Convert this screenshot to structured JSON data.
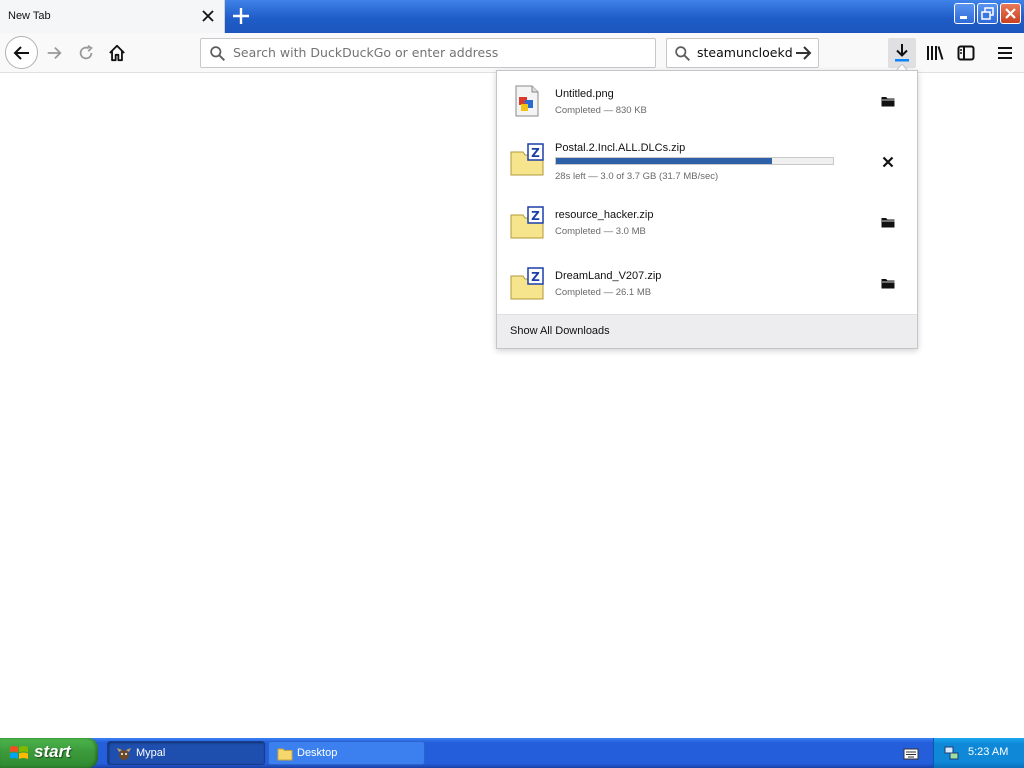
{
  "tab": {
    "title": "New Tab"
  },
  "nav": {
    "url_placeholder": "Search with DuckDuckGo or enter address",
    "search_value": "steamuncloekdd"
  },
  "downloads": {
    "items": [
      {
        "name": "Untitled.png",
        "status": "Completed — 830 KB",
        "kind": "image",
        "action": "open-folder"
      },
      {
        "name": "Postal.2.Incl.ALL.DLCs.zip",
        "status": "28s left — 3.0 of 3.7 GB (31.7 MB/sec)",
        "kind": "zip",
        "action": "cancel",
        "progress": 0.78
      },
      {
        "name": "resource_hacker.zip",
        "status": "Completed — 3.0 MB",
        "kind": "zip",
        "action": "open-folder"
      },
      {
        "name": "DreamLand_V207.zip",
        "status": "Completed — 26.1 MB",
        "kind": "zip",
        "action": "open-folder"
      }
    ],
    "footer": "Show All Downloads"
  },
  "taskbar": {
    "start": "start",
    "tasks": [
      {
        "label": "Mypal",
        "active": true
      },
      {
        "label": "Desktop",
        "active": false
      }
    ],
    "clock": "5:23 AM"
  },
  "colors": {
    "progress": "#2f61a8",
    "taskbar": "#245edb",
    "start": "#3c9a3c"
  }
}
